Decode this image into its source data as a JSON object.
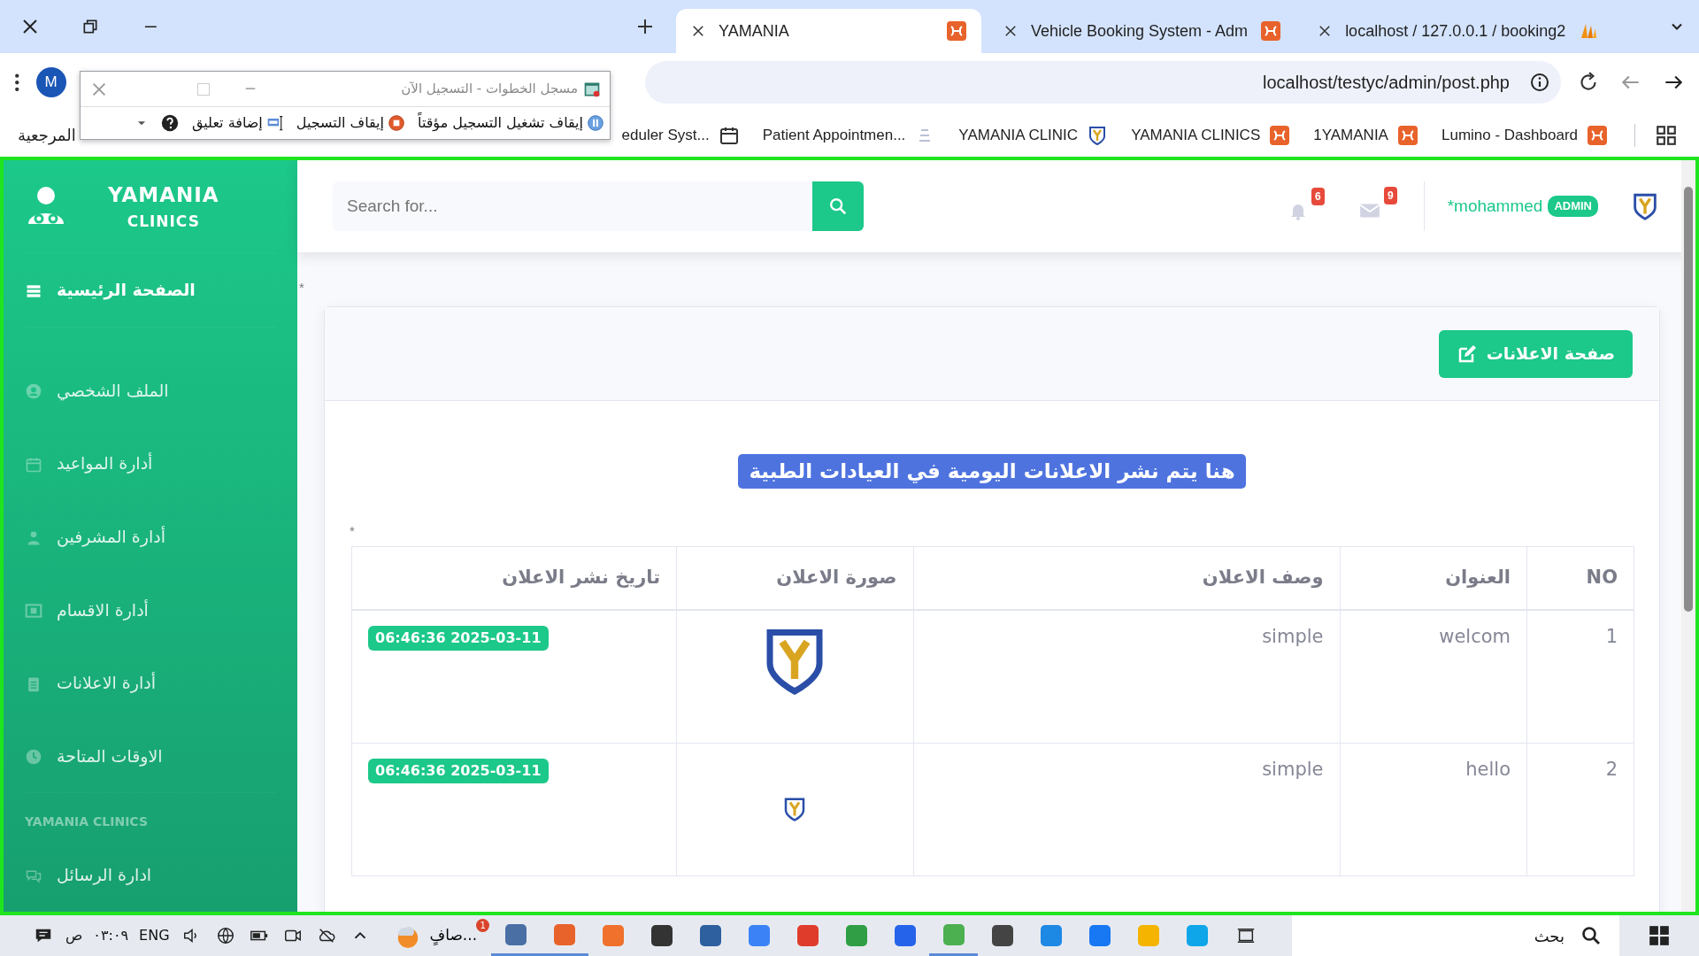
{
  "browser": {
    "tabs": [
      {
        "title": "localhost / 127.0.0.1 / booking2",
        "kind": "pma",
        "selected": false
      },
      {
        "title": "Vehicle Booking System - Adm",
        "kind": "xampp",
        "selected": false
      },
      {
        "title": "YAMANIA",
        "kind": "xampp",
        "selected": true
      }
    ],
    "profile_initial": "M",
    "address": "localhost/testyc/admin/post.php",
    "bookmarks": [
      {
        "label": "Lumino - Dashboard",
        "kind": "xampp"
      },
      {
        "label": "1YAMANIA",
        "kind": "xampp"
      },
      {
        "label": "YAMANIA CLINICS",
        "kind": "xampp"
      },
      {
        "label": "YAMANIA CLINIC",
        "kind": "logo"
      },
      {
        "label": "Patient Appointmen...",
        "kind": "page"
      },
      {
        "label": "eduler Syst...",
        "kind": "calendar"
      }
    ],
    "bookmarks_tail": "المرجعية"
  },
  "steps_recorder": {
    "title": "مسجل الخطوات - التسجيل الآن",
    "buttons": [
      {
        "label": "إيقاف تشغيل التسجيل مؤقتاً",
        "kind": "pause"
      },
      {
        "label": "إيقاف التسجيل",
        "kind": "stop"
      },
      {
        "label": "إضافة تعليق",
        "kind": "comment"
      }
    ]
  },
  "sidebar": {
    "brand": [
      "YAMANIA",
      "CLINICS"
    ],
    "items": [
      {
        "label": "الصفحة الرئيسية",
        "kind": "bars",
        "selected": true
      },
      {
        "label": "الملف الشخصي",
        "kind": "user-circle",
        "selected": false
      },
      {
        "label": "أدارة المواعيد",
        "kind": "calendar",
        "selected": false
      },
      {
        "label": "أدارة المشرفين",
        "kind": "user",
        "selected": false
      },
      {
        "label": "أدارة الاقسام",
        "kind": "image",
        "selected": false
      },
      {
        "label": "أدارة الاعلانات",
        "kind": "clipboard",
        "selected": false
      },
      {
        "label": "الاوقات المتاحة",
        "kind": "clock",
        "selected": false
      }
    ],
    "heading": "YAMANIA CLINICS",
    "items2": [
      {
        "label": "ادارة الرسائل",
        "kind": "comments",
        "selected": false
      }
    ]
  },
  "topbar": {
    "search": {
      "placeholder": "Search for..."
    },
    "alerts_count": "6",
    "messages_count": "9",
    "user": "*mohammed",
    "role": "ADMIN"
  },
  "content": {
    "marks": [
      "*",
      "*"
    ],
    "button": "صفحة الاعلانات",
    "banner": "هنا يتم نشر الاعلانات اليومية في العيادات الطبية",
    "table": {
      "columns": [
        "NO",
        "العنوان",
        "وصف الاعلان",
        "صورة الاعلان",
        "تاريخ نشر الاعلان"
      ],
      "rows": [
        {
          "no": "1",
          "title": "welcom",
          "description": "simple",
          "date": "06:46:36 2025-03-11"
        },
        {
          "no": "2",
          "title": "hello",
          "description": "simple",
          "date": "06:46:36 2025-03-11"
        }
      ]
    }
  },
  "taskbar": {
    "ampm": "ص",
    "clock": "٠٣:٠٩",
    "language": "ENG",
    "weather": "صافٍ...",
    "weather_badge": "1",
    "apps": [
      {
        "color": "#4a6fa5",
        "active": true
      },
      {
        "color": "#e8632b",
        "active": true
      },
      {
        "color": "#f0712c",
        "active": false
      },
      {
        "color": "#333333",
        "active": false
      },
      {
        "color": "#2e5f9e",
        "active": false
      },
      {
        "color": "#3b82f6",
        "active": false
      },
      {
        "color": "#e03c2c",
        "active": false
      },
      {
        "color": "#2f9e44",
        "active": false
      },
      {
        "color": "#2563eb",
        "active": false
      },
      {
        "color": "#4caf50",
        "active": true
      },
      {
        "color": "#444444",
        "active": false
      },
      {
        "color": "#1e88e5",
        "active": false
      },
      {
        "color": "#1877f2",
        "active": false
      },
      {
        "color": "#f4b400",
        "active": false
      },
      {
        "color": "#0ea5e9",
        "active": false
      }
    ],
    "search_placeholder": "بحث"
  }
}
